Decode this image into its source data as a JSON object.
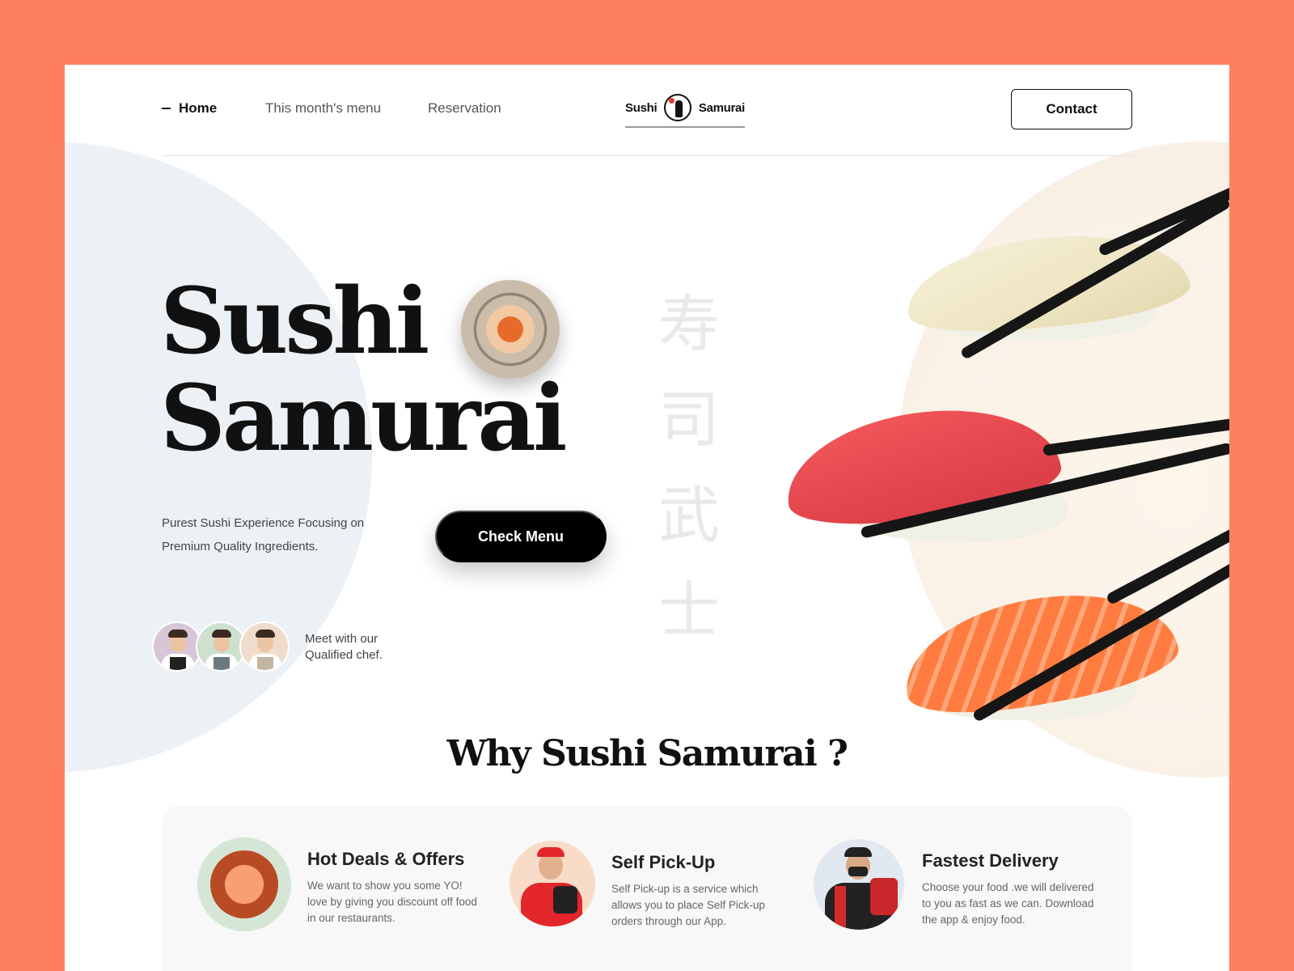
{
  "nav": {
    "home": "Home",
    "menu": "This month's menu",
    "reservation": "Reservation",
    "logo_left": "Sushi",
    "logo_right": "Samurai",
    "contact": "Contact"
  },
  "hero": {
    "title_line1": "Sushi",
    "title_line2": "Samurai",
    "kanji": [
      "寿",
      "司",
      "武",
      "士"
    ],
    "tagline": "Purest Sushi Experience Focusing on Premium Quality Ingredients.",
    "cta": "Check Menu",
    "chef_note_line1": "Meet with our",
    "chef_note_line2": "Qualified chef."
  },
  "why": {
    "title": "Why Sushi Samurai ?",
    "features": [
      {
        "title": "Hot Deals & Offers",
        "desc": "We want to show you some YO! love by giving you discount off food in our restaurants."
      },
      {
        "title": "Self Pick-Up",
        "desc": "Self Pick-up is a service which allows you to place Self Pick-up orders through our App."
      },
      {
        "title": "Fastest Delivery",
        "desc": "Choose your food .we will delivered to you as fast as we can. Download the app & enjoy food."
      }
    ]
  },
  "colors": {
    "page_background": "#FF805E",
    "card": "#FFFFFF",
    "primary_text": "#111111",
    "cta_background": "#000000",
    "left_blob": "#ECF1F5",
    "right_blob": "#FAF1E7"
  },
  "icons": {
    "logo": "samurai-logo-icon",
    "nav_active": "dash-icon"
  }
}
